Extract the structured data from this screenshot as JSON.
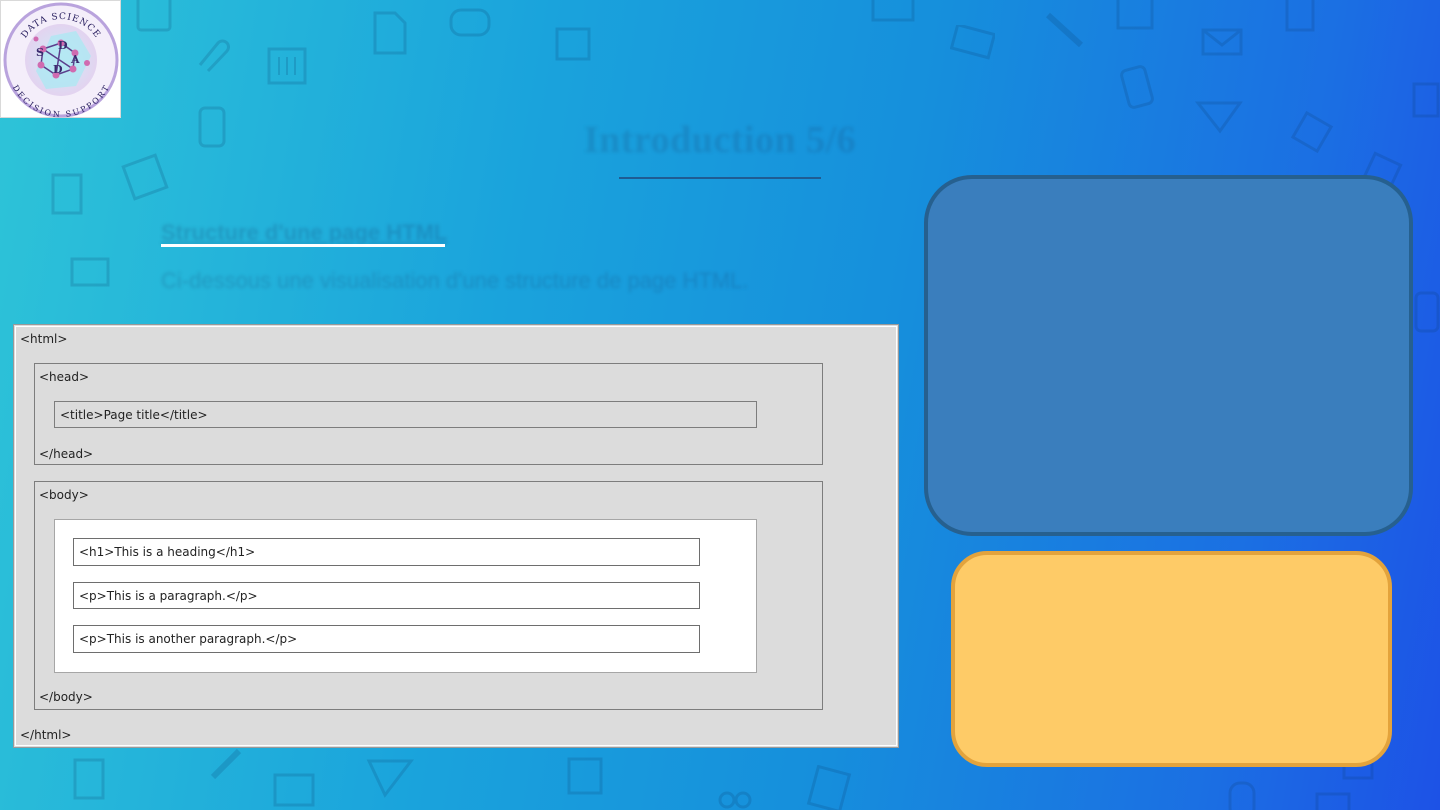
{
  "logo": {
    "top_text": "DATA SCIENCE",
    "bottom_text": "DECISION SUPPORT",
    "letters": [
      "S",
      "D",
      "D",
      "A"
    ]
  },
  "slide": {
    "title": "Introduction 5/6",
    "subtitle": "Structure d'une page HTML",
    "description": "Ci-dessous une visualisation d'une structure de page HTML."
  },
  "diagram": {
    "html_open": "<html>",
    "head_open": "<head>",
    "title_line": "<title>Page title</title>",
    "head_close": "</head>",
    "body_open": "<body>",
    "h1_line": "<h1>This is a heading</h1>",
    "p1_line": "<p>This is a paragraph.</p>",
    "p2_line": "<p>This is another paragraph.</p>",
    "body_close": "</body>",
    "html_close": "</html>"
  },
  "colors": {
    "background_start": "#2ec4d8",
    "background_end": "#1d52e6",
    "blue_card": "#3a7ebd",
    "yellow_card": "#fecb67"
  }
}
